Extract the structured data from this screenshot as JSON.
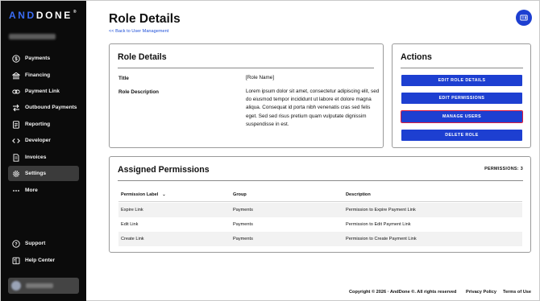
{
  "brand": {
    "logo_accent": "AND",
    "logo_rest": "DONE",
    "logo_mark": "®",
    "accent_color": "#1d3fd1"
  },
  "sidebar": {
    "items": [
      {
        "label": "Payments",
        "icon": "dollar-circle-icon"
      },
      {
        "label": "Financing",
        "icon": "bank-icon"
      },
      {
        "label": "Payment Link",
        "icon": "link-icon"
      },
      {
        "label": "Outbound Payments",
        "icon": "transfer-arrows-icon"
      },
      {
        "label": "Reporting",
        "icon": "report-icon"
      },
      {
        "label": "Developer",
        "icon": "code-icon"
      },
      {
        "label": "Invoices",
        "icon": "invoice-icon"
      },
      {
        "label": "Settings",
        "icon": "gear-icon",
        "active": true
      },
      {
        "label": "More",
        "icon": "more-dots-icon"
      }
    ],
    "bottom": [
      {
        "label": "Support",
        "icon": "question-circle-icon"
      },
      {
        "label": "Help Center",
        "icon": "book-icon"
      }
    ]
  },
  "header": {
    "title": "Role Details",
    "back_link": "<< Back to User Management"
  },
  "role_card": {
    "title": "Role Details",
    "fields": [
      {
        "label": "Title",
        "value": "[Role Name]"
      },
      {
        "label": "Role Description",
        "value": "Lorem ipsum dolor sit amet, consectetur adipiscing elit, sed do eiusmod tempor incididunt ut labore et dolore magna aliqua. Consequat id porta nibh venenatis cras sed felis eget. Sed sed risus pretium quam vulputate dignissim suspendisse in est."
      }
    ]
  },
  "actions_card": {
    "title": "Actions",
    "buttons": [
      {
        "label": "EDIT ROLE DETAILS"
      },
      {
        "label": "EDIT PERMISSIONS"
      },
      {
        "label": "MANAGE USERS",
        "focused": true
      },
      {
        "label": "DELETE ROLE"
      }
    ]
  },
  "permissions_card": {
    "title": "Assigned Permissions",
    "count_label": "PERMISSIONS: 3",
    "columns": [
      "Permission Label",
      "Group",
      "Description"
    ],
    "rows": [
      {
        "label": "Expire Link",
        "group": "Payments",
        "description": "Permission to Expire Payment Link"
      },
      {
        "label": "Edit Link",
        "group": "Payments",
        "description": "Permission to Edit Payment Link"
      },
      {
        "label": "Create Link",
        "group": "Payments",
        "description": "Permission to Create Payment Link"
      }
    ]
  },
  "footer": {
    "copyright": "Copyright © 2026 · AndDone ®. All rights reserved",
    "privacy": "Privacy Policy",
    "terms": "Terms of Use"
  }
}
